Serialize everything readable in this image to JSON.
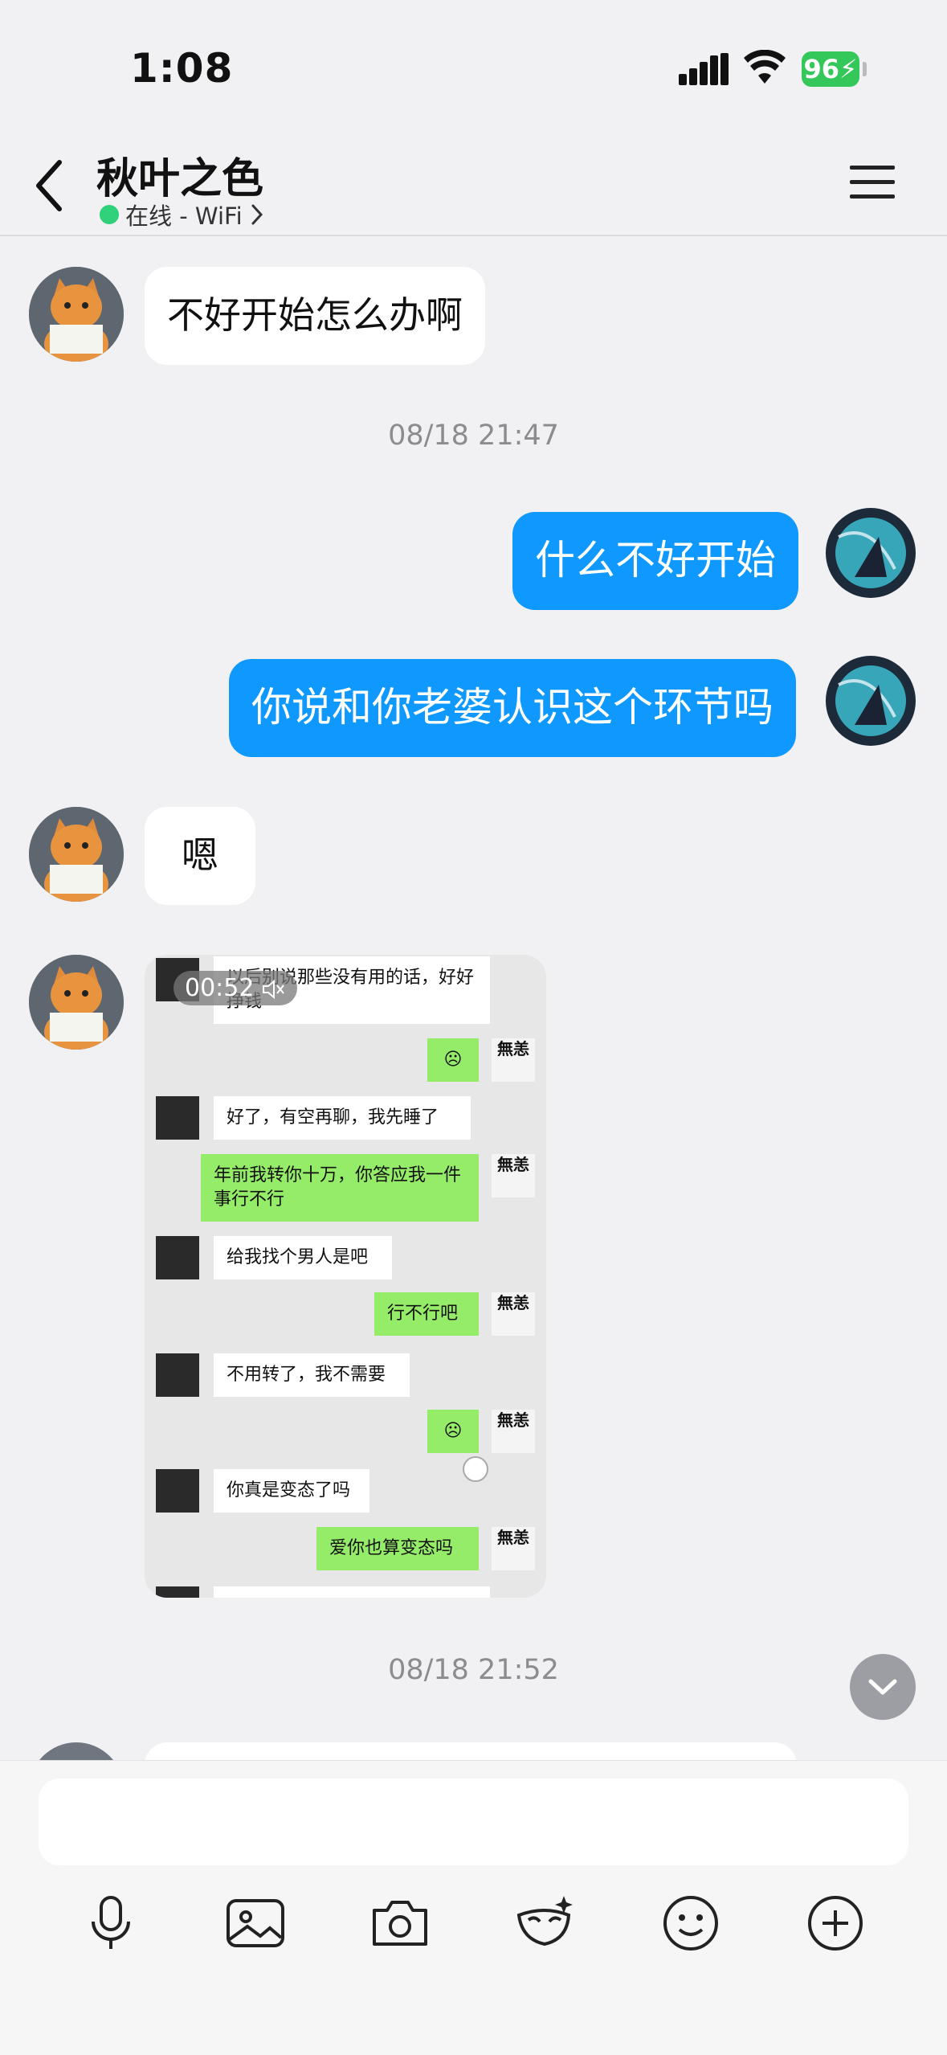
{
  "status_bar": {
    "time": "1:08",
    "battery": "96"
  },
  "header": {
    "title": "秋叶之色",
    "status": "在线 - WiFi"
  },
  "messages": [
    {
      "side": "in",
      "text": "不好开始怎么办啊"
    },
    {
      "side": "time",
      "text": "08/18 21:47"
    },
    {
      "side": "out",
      "text": "什么不好开始"
    },
    {
      "side": "out",
      "text": "你说和你老婆认识这个环节吗"
    },
    {
      "side": "in",
      "text": "嗯"
    },
    {
      "side": "time",
      "text": "08/18 21:52"
    }
  ],
  "image_card": {
    "video_duration": "00:52",
    "chat": [
      {
        "side": "in",
        "text": "以后别说那些没有用的话，好好挣钱"
      },
      {
        "side": "out",
        "text": "☹"
      },
      {
        "side": "in",
        "text": "好了，有空再聊，我先睡了"
      },
      {
        "side": "out",
        "text": "年前我转你十万，你答应我一件事行不行"
      },
      {
        "side": "in",
        "text": "给我找个男人是吧"
      },
      {
        "side": "out",
        "text": "行不行吧"
      },
      {
        "side": "in",
        "text": "不用转了，我不需要"
      },
      {
        "side": "out",
        "text": "☹"
      },
      {
        "side": "in",
        "text": "你真是变态了吗"
      },
      {
        "side": "out",
        "text": "爱你也算变态吗"
      }
    ],
    "avatar_glyph": "無恙"
  },
  "input": {
    "placeholder": ""
  },
  "toolbar": {
    "icons": [
      "microphone-icon",
      "image-icon",
      "camera-icon",
      "mask-icon",
      "emoji-icon",
      "plus-icon"
    ]
  },
  "colors": {
    "out_bubble": "#0f99ff",
    "wx_out": "#95ec69",
    "online_dot": "#2fd17a"
  }
}
